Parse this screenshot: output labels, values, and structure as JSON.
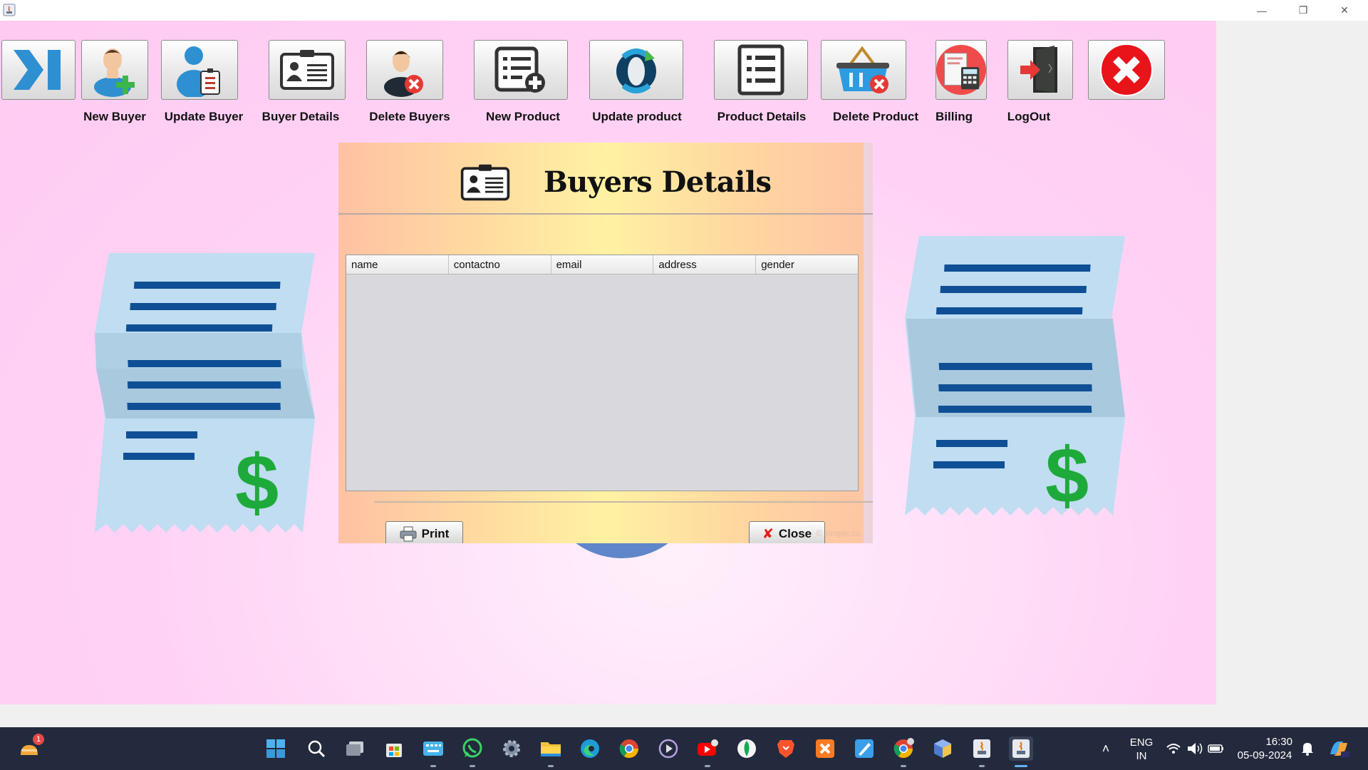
{
  "toolbar": {
    "buttons": [
      {
        "label": "",
        "icon": "collapse-arrow-icon"
      },
      {
        "label": "New Buyer",
        "icon": "add-user-icon"
      },
      {
        "label": "Update Buyer",
        "icon": "update-user-icon"
      },
      {
        "label": "Buyer Details",
        "icon": "id-card-icon"
      },
      {
        "label": "Delete Buyers",
        "icon": "delete-user-icon"
      },
      {
        "label": "New Product",
        "icon": "add-list-icon"
      },
      {
        "label": "Update product",
        "icon": "refresh-icon"
      },
      {
        "label": "Product Details",
        "icon": "list-icon"
      },
      {
        "label": "Delete Product",
        "icon": "delete-basket-icon"
      },
      {
        "label": "Billing",
        "icon": "calculator-icon"
      },
      {
        "label": "LogOut",
        "icon": "logout-door-icon"
      },
      {
        "label": "",
        "icon": "exit-icon"
      }
    ]
  },
  "dialog": {
    "title": "Buyers Details",
    "columns": [
      "name",
      "contactno",
      "email",
      "address",
      "gender"
    ],
    "rows": [],
    "print_label": "Print",
    "close_label": "Close",
    "watermark": "© simple.co"
  },
  "taskbar": {
    "weather_badge": "1",
    "language": "ENG",
    "region": "IN",
    "time": "16:30",
    "date": "05-09-2024"
  },
  "colors": {
    "background_pink": "#ffcaf2",
    "receipt_blue": "#c0ddf1",
    "receipt_line": "#0f4f95",
    "dollar_green": "#1eaa3a",
    "taskbar": "#232a3d"
  }
}
